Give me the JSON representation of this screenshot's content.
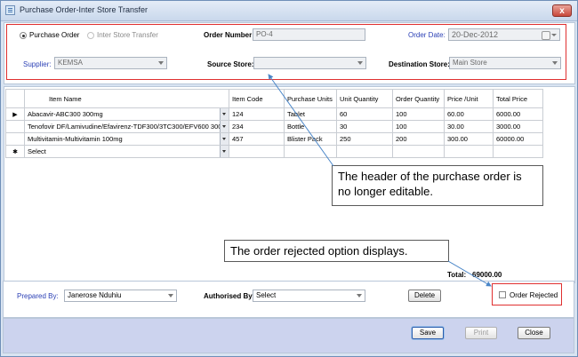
{
  "window": {
    "title": "Purchase Order-Inter Store Transfer",
    "close_glyph": "x"
  },
  "header": {
    "radio_purchase_order": "Purchase Order",
    "radio_inter_store": "Inter Store Transfer",
    "order_number_label": "Order Number:",
    "order_number_value": "PO-4",
    "order_date_label": "Order Date:",
    "order_date_value": "20-Dec-2012",
    "supplier_label": "Supplier:",
    "supplier_value": "KEMSA",
    "source_store_label": "Source Store:",
    "source_store_value": "",
    "destination_store_label": "Destination Store:",
    "destination_store_value": "Main Store"
  },
  "grid": {
    "columns": [
      "Item Name",
      "Item Code",
      "Purchase Units",
      "Unit Quantity",
      "Order Quantity",
      "Price /Unit",
      "Total Price"
    ],
    "rows": [
      {
        "marker": "▶",
        "item_name": "Abacavir-ABC300 300mg",
        "item_code": "124",
        "purchase_units": "Tablet",
        "unit_quantity": "60",
        "order_quantity": "100",
        "price_unit": "60.00",
        "total_price": "6000.00"
      },
      {
        "marker": "",
        "item_name": "Tenofovir DF/Lamivudine/Efavirenz-TDF300/3TC300/EFV600 300...",
        "item_code": "234",
        "purchase_units": "Bottle",
        "unit_quantity": "30",
        "order_quantity": "100",
        "price_unit": "30.00",
        "total_price": "3000.00"
      },
      {
        "marker": "",
        "item_name": "Multivitamin-Multivitamin 100mg",
        "item_code": "457",
        "purchase_units": "Blister Pack",
        "unit_quantity": "250",
        "order_quantity": "200",
        "price_unit": "300.00",
        "total_price": "60000.00"
      }
    ],
    "new_row": {
      "marker": "✱",
      "item_name": "Select"
    }
  },
  "totals": {
    "label": "Total:",
    "value": "69000.00"
  },
  "bottom": {
    "prepared_by_label": "Prepared By:",
    "prepared_by_value": "Janerose Nduhiu",
    "authorised_by_label": "Authorised By:",
    "authorised_by_value": "Select",
    "delete_label": "Delete",
    "order_rejected_label": "Order Rejected"
  },
  "footer": {
    "save_label": "Save",
    "print_label": "Print",
    "close_label": "Close"
  },
  "callouts": {
    "header_note": "The header of the purchase order is no longer editable.",
    "rejected_note": "The order rejected option displays."
  },
  "colors": {
    "annotation_red": "#e03030",
    "label_blue": "#2a3fb5",
    "footer_bg": "#ccd3ee"
  }
}
